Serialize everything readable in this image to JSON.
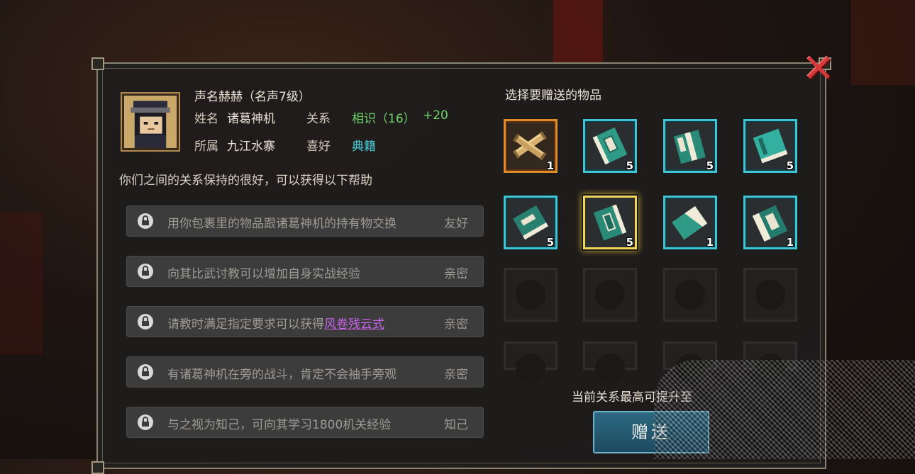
{
  "header": {
    "reputation": "声名赫赫（名声7级）",
    "name_label": "姓名",
    "name_value": "诸葛神机",
    "relation_label": "关系",
    "relation_value": "相识（16）",
    "relation_bonus": "+20",
    "faction_label": "所属",
    "faction_value": "九江水寨",
    "hobby_label": "喜好",
    "hobby_value": "典籍"
  },
  "help": {
    "title": "你们之间的关系保持的很好，可以获得以下帮助",
    "rows": [
      {
        "text": "用你包裹里的物品跟诸葛神机的持有物交换",
        "level": "友好"
      },
      {
        "text": "向其比武讨教可以增加自身实战经验",
        "level": "亲密"
      },
      {
        "text_before": "请教时满足指定要求可以获得",
        "link": "风卷残云式",
        "level": "亲密"
      },
      {
        "text": "有诸葛神机在旁的战斗，肯定不会袖手旁观",
        "level": "亲密"
      },
      {
        "text": "与之视为知己，可向其学习1800机关经验",
        "level": "知己"
      }
    ]
  },
  "gift": {
    "title": "选择要赠送的物品",
    "items": [
      {
        "icon": "scroll-bundle-icon",
        "count": "1",
        "border": "orange"
      },
      {
        "icon": "book-icon",
        "count": "5",
        "border": "cyan"
      },
      {
        "icon": "book-icon",
        "count": "5",
        "border": "cyan"
      },
      {
        "icon": "book-icon",
        "count": "5",
        "border": "cyan"
      },
      {
        "icon": "book-icon",
        "count": "5",
        "border": "cyan"
      },
      {
        "icon": "book-icon",
        "count": "5",
        "border": "gold-selected"
      },
      {
        "icon": "book-icon",
        "count": "1",
        "border": "cyan"
      },
      {
        "icon": "book-icon",
        "count": "1",
        "border": "cyan"
      }
    ],
    "note": "当前关系最高可提升至",
    "give_button": "赠送"
  },
  "colors": {
    "relation_green": "#6fd36a",
    "hobby_cyan": "#4ad2de",
    "link_purple": "#c764e8",
    "slot_cyan": "#3ec6d6",
    "slot_orange": "#e08a2a",
    "slot_selected": "#f1d45a",
    "close_red": "#d43a3a"
  }
}
